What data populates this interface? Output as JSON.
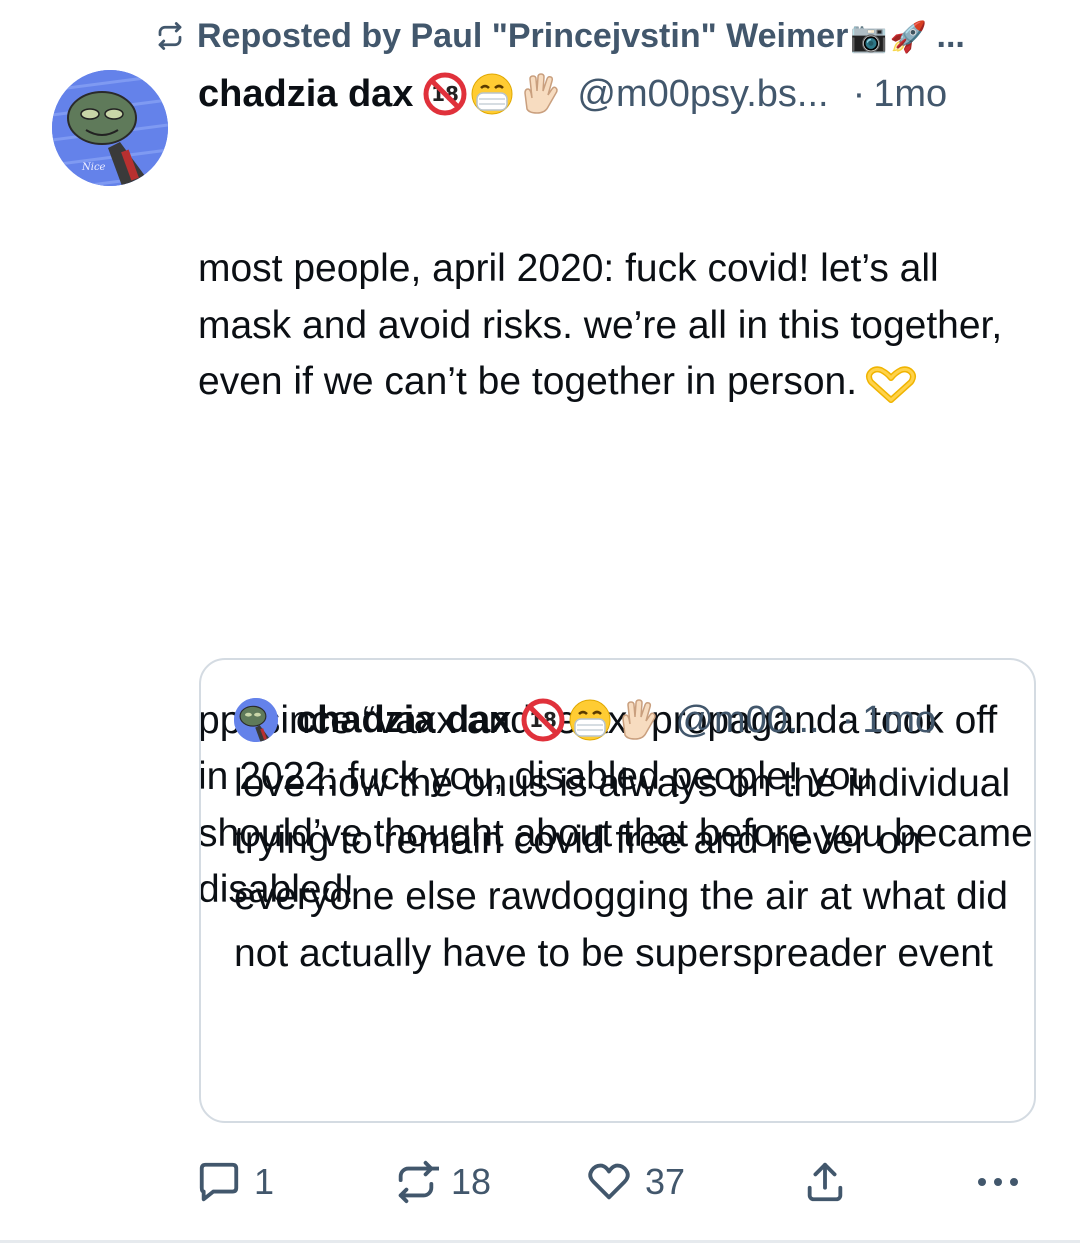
{
  "repost": {
    "prefix": "Reposted by ",
    "reposter": "Paul \"Princejvstin\" Weimer",
    "camera_emoji": "📷",
    "rocket_emoji": "🚀",
    "ellipsis": " ...",
    "icon": "repost-icon"
  },
  "post": {
    "display_name": "chadzia dax",
    "handle": "@m00psy.bs...",
    "dot": "·",
    "time": "1mo",
    "badges": [
      "no-under-18-icon",
      "medical-mask-emoji",
      "vulcan-salute-emoji"
    ],
    "paragraphs": [
      "most people, april 2020: fuck covid! let’s all mask and avoid risks. we’re all in this together, even if we can’t be together in person.",
      "ppl since “vaxx and relax” propaganda took off in 2022: fuck you, disabled people! you should’ve thought about that before you became disabled!"
    ],
    "trailing_emoji": "heart-hands-emoji"
  },
  "quote": {
    "display_name": "chadzia dax",
    "handle": "@m00...",
    "dot": "·",
    "time": "1mo",
    "text": "love how the onus is always on the individual trying to remain covid free and never on everyone else rawdogging the air at what did not actually have to be superspreader event"
  },
  "actions": {
    "reply_count": "1",
    "repost_count": "18",
    "like_count": "37"
  },
  "colors": {
    "text": "#0b0f14",
    "muted": "#42576c",
    "border": "#d4dbe2",
    "avatar_bg": "#5b7be8"
  }
}
